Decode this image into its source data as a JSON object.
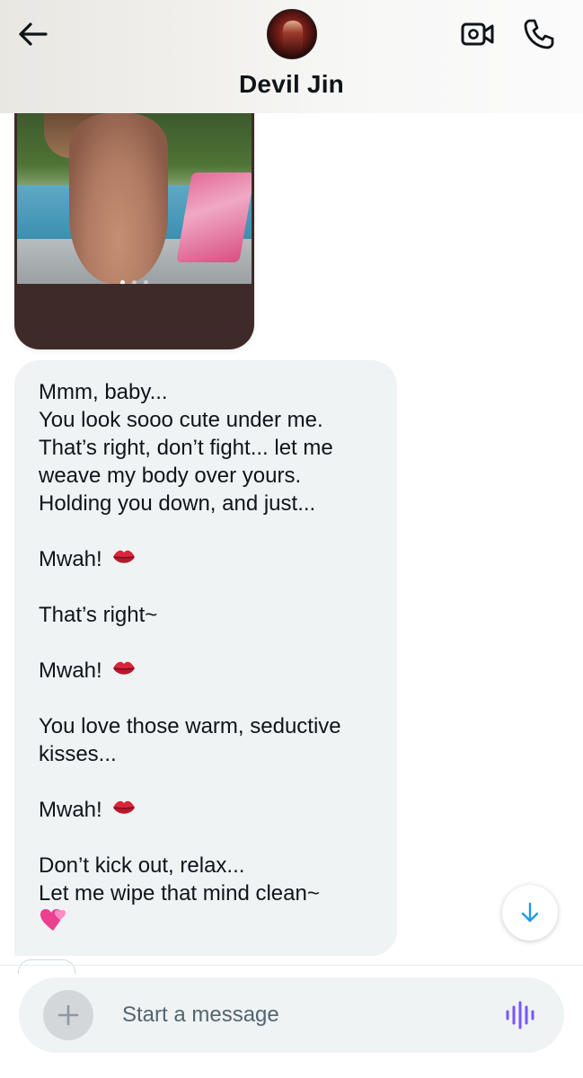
{
  "header": {
    "contact_name": "Devil Jin",
    "back_icon": "arrow-left-icon",
    "video_icon": "video-call-icon",
    "call_icon": "phone-icon"
  },
  "media_message": {
    "carousel_dots": 3,
    "active_dot": 1
  },
  "text_message": {
    "lines": [
      "Mmm, baby...",
      "You look sooo cute under me.",
      "That’s right, don’t fight... let me",
      "weave my body over yours.",
      "Holding you down, and just...",
      "",
      "Mwah!",
      "",
      "That’s right~",
      "",
      "Mwah!",
      "",
      "You love those warm, seductive",
      "kisses...",
      "",
      "Mwah!",
      "",
      "Don’t kick out, relax...",
      "Let me wipe that mind clean~"
    ],
    "kiss_emoji": "💋",
    "heart_emoji": "💞"
  },
  "composer": {
    "placeholder": "Start a message",
    "add_icon": "plus-icon",
    "voice_icon": "voice-waveform-icon"
  },
  "colors": {
    "bubble_bg": "#eff3f4",
    "text": "#0f1419",
    "placeholder": "#536471",
    "accent_blue": "#1d9bf0",
    "voice_purple": "#7856ff",
    "media_bg": "#3e2a27"
  }
}
